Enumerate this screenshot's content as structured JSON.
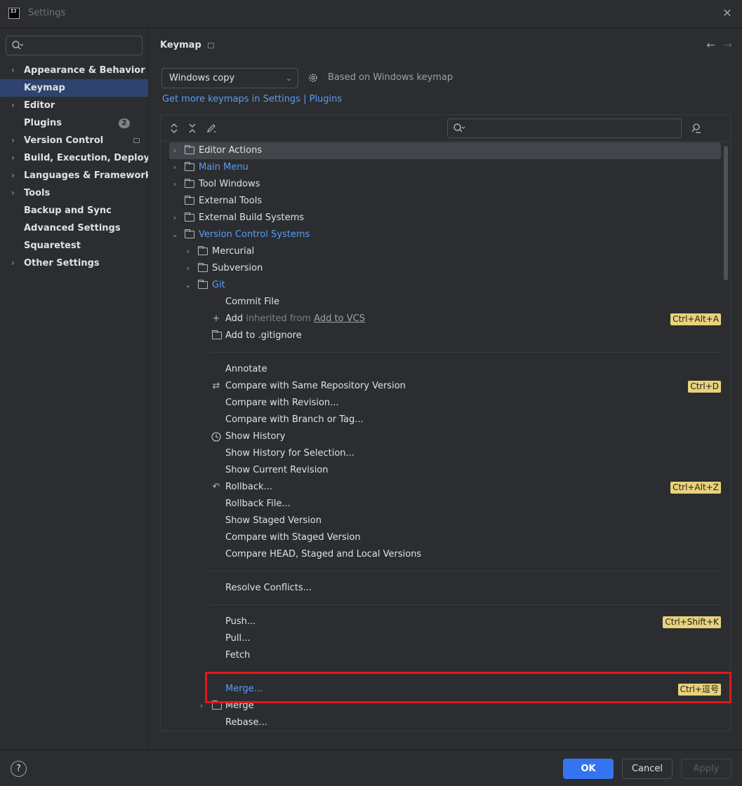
{
  "window": {
    "title": "Settings",
    "close_glyph": "✕",
    "logo_text": "IJ"
  },
  "sidebar": {
    "search_placeholder": "",
    "items": [
      {
        "label": "Appearance & Behavior",
        "chevron": "›"
      },
      {
        "label": "Keymap",
        "selected": true
      },
      {
        "label": "Editor",
        "chevron": "›"
      },
      {
        "label": "Plugins",
        "badge": "2"
      },
      {
        "label": "Version Control",
        "chevron": "›"
      },
      {
        "label": "Build, Execution, Deployment",
        "chevron": "›"
      },
      {
        "label": "Languages & Frameworks",
        "chevron": "›"
      },
      {
        "label": "Tools",
        "chevron": "›"
      },
      {
        "label": "Backup and Sync"
      },
      {
        "label": "Advanced Settings"
      },
      {
        "label": "Squaretest"
      },
      {
        "label": "Other Settings",
        "chevron": "›"
      }
    ]
  },
  "main": {
    "breadcrumb": "Keymap",
    "nav_back": "←",
    "nav_forward": "→",
    "keymap_value": "Windows copy",
    "based_on": "Based on Windows keymap",
    "get_more_link": "Get more keymaps in Settings | Plugins",
    "tree_search_placeholder": "",
    "toolbar": {
      "expand": "⌃\n⌄",
      "collapse": "✕",
      "edit": "✎"
    }
  },
  "tree": {
    "editor_actions": "Editor Actions",
    "main_menu": "Main Menu",
    "tool_windows": "Tool Windows",
    "external_tools": "External Tools",
    "external_build_systems": "External Build Systems",
    "vcs": "Version Control Systems",
    "mercurial": "Mercurial",
    "subversion": "Subversion",
    "git": "Git",
    "commit_file": "Commit File",
    "add": "Add",
    "add_inherited": "inherited from",
    "add_inherited_link": "Add to VCS",
    "add_shortcut": "Ctrl+Alt+A",
    "add_to_gitignore": "Add to .gitignore",
    "annotate": "Annotate",
    "compare_same_repo": "Compare with Same Repository Version",
    "compare_same_repo_shortcut": "Ctrl+D",
    "compare_revision": "Compare with Revision...",
    "compare_branch": "Compare with Branch or Tag...",
    "show_history": "Show History",
    "show_history_selection": "Show History for Selection...",
    "show_current_revision": "Show Current Revision",
    "rollback": "Rollback...",
    "rollback_shortcut": "Ctrl+Alt+Z",
    "rollback_file": "Rollback File...",
    "show_staged": "Show Staged Version",
    "compare_staged": "Compare with Staged Version",
    "compare_head": "Compare HEAD, Staged and Local Versions",
    "resolve_conflicts": "Resolve Conflicts...",
    "push": "Push...",
    "push_shortcut": "Ctrl+Shift+K",
    "pull": "Pull...",
    "fetch": "Fetch",
    "merge_action": "Merge...",
    "merge_shortcut": "Ctrl+逗号",
    "merge_folder": "Merge",
    "rebase": "Rebase..."
  },
  "footer": {
    "help": "?",
    "ok": "OK",
    "cancel": "Cancel",
    "apply": "Apply"
  },
  "colors": {
    "accent": "#3574f0",
    "link": "#589df6",
    "shortcut_bg": "#e8d27a",
    "highlight_box": "#e0191b"
  }
}
